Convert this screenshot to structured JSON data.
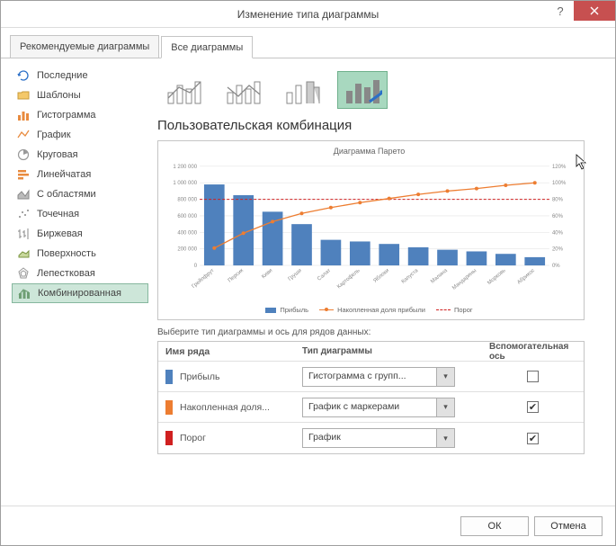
{
  "window": {
    "title": "Изменение типа диаграммы"
  },
  "tabs": [
    {
      "label": "Рекомендуемые диаграммы"
    },
    {
      "label": "Все диаграммы"
    }
  ],
  "activeTab": 1,
  "sidebar": {
    "items": [
      {
        "label": "Последние"
      },
      {
        "label": "Шаблоны"
      },
      {
        "label": "Гистограмма"
      },
      {
        "label": "График"
      },
      {
        "label": "Круговая"
      },
      {
        "label": "Линейчатая"
      },
      {
        "label": "С областями"
      },
      {
        "label": "Точечная"
      },
      {
        "label": "Биржевая"
      },
      {
        "label": "Поверхность"
      },
      {
        "label": "Лепестковая"
      },
      {
        "label": "Комбинированная"
      }
    ],
    "selectedIndex": 11
  },
  "sectionTitle": "Пользовательская комбинация",
  "chart_data": {
    "type": "bar",
    "title": "Диаграмма Парето",
    "categories": [
      "Грейпфрут",
      "Персик",
      "Киви",
      "Груши",
      "Салат",
      "Картофель",
      "Яблоки",
      "Капуста",
      "Малина",
      "Мандарины",
      "Морковь",
      "Абрикос"
    ],
    "series": [
      {
        "name": "Прибыль",
        "type": "bar",
        "values": [
          980000,
          850000,
          650000,
          500000,
          310000,
          290000,
          260000,
          220000,
          190000,
          170000,
          140000,
          100000
        ]
      },
      {
        "name": "Накопленная доля прибыли",
        "type": "line_markers",
        "secondary_axis": true,
        "values": [
          21,
          39,
          53,
          63,
          70,
          76,
          81,
          86,
          90,
          93,
          97,
          100
        ]
      },
      {
        "name": "Порог",
        "type": "line_dashed",
        "secondary_axis": true,
        "value": 80
      }
    ],
    "ylabel": "",
    "ylim": [
      0,
      1200000
    ],
    "y_ticks": [
      0,
      200000,
      400000,
      600000,
      800000,
      1000000,
      1200000
    ],
    "y2lim": [
      0,
      120
    ],
    "y2_ticks": [
      "0%",
      "20%",
      "40%",
      "60%",
      "80%",
      "100%",
      "120%"
    ]
  },
  "seriesGrid": {
    "prompt": "Выберите тип диаграммы и ось для рядов данных:",
    "headers": {
      "name": "Имя ряда",
      "type": "Тип диаграммы",
      "aux": "Вспомогательная ось"
    },
    "rows": [
      {
        "name": "Прибыль",
        "color": "#4f81bd",
        "type": "Гистограмма с групп...",
        "aux": false
      },
      {
        "name": "Накопленная доля...",
        "color": "#ed7d31",
        "type": "График с маркерами",
        "aux": true
      },
      {
        "name": "Порог",
        "color": "#d02020",
        "type": "График",
        "aux": true
      }
    ]
  },
  "footer": {
    "ok": "ОК",
    "cancel": "Отмена"
  }
}
